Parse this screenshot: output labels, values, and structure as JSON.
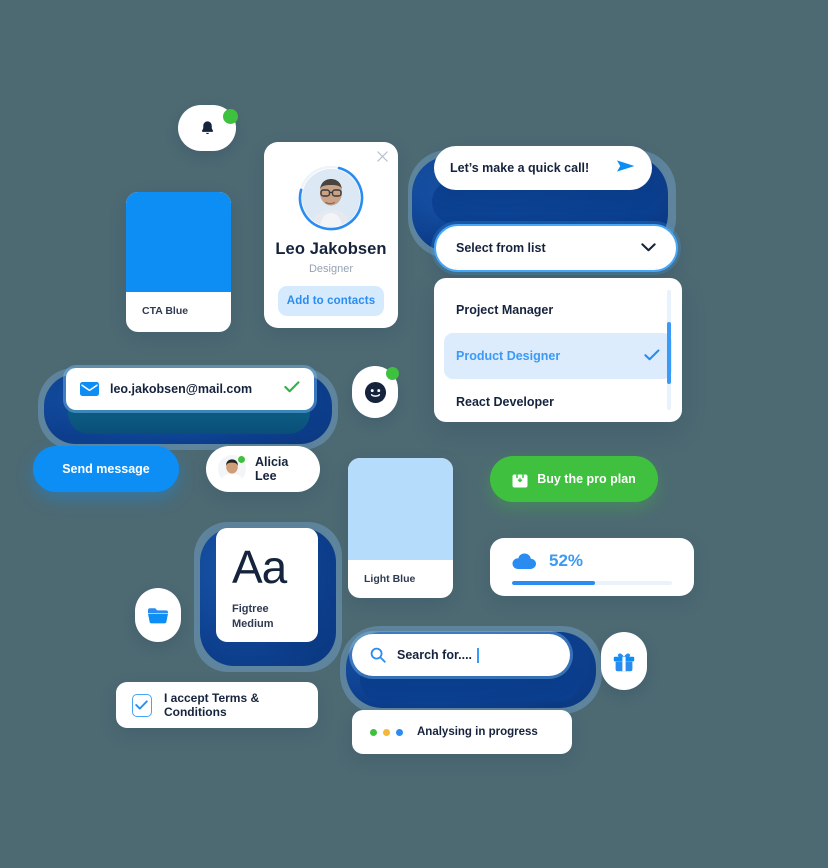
{
  "theme": {
    "background": "#4d6a73",
    "cta_blue": "#0d8ef5",
    "light_blue": "#b5dcfa",
    "navy": "#16233d",
    "green": "#3fc13f",
    "deep_navy_blob": "#0d3f8e"
  },
  "notification": {
    "icon": "bell-icon",
    "badge_color": "#3ec13e"
  },
  "profile_card": {
    "close_label": "×",
    "avatar_alt": "Leo Jakobsen avatar",
    "ring_progress": 75,
    "name": "Leo Jakobsen",
    "role": "Designer",
    "button_label": "Add to contacts"
  },
  "chat_bubble": {
    "message": "Let’s make a quick call!",
    "send_icon": "send-icon"
  },
  "select": {
    "value": "Select from list",
    "chevron_icon": "chevron-down-icon",
    "options": [
      {
        "label": "Project Manager",
        "selected": false
      },
      {
        "label": "Product Designer",
        "selected": true
      },
      {
        "label": "React Developer",
        "selected": false
      }
    ],
    "scrollbar_thumb_percent": 55
  },
  "swatches": [
    {
      "name": "CTA Blue",
      "color": "#0d8ef5"
    },
    {
      "name": "Light Blue",
      "color": "#b5dcfa"
    }
  ],
  "email_field": {
    "icon": "envelope-icon",
    "value": "leo.jakobsen@mail.com",
    "valid_icon": "check-icon",
    "valid_color": "#2fb344"
  },
  "send_button": {
    "label": "Send message"
  },
  "contact_chip": {
    "name": "Alicia Lee",
    "status": "online",
    "status_color": "#3ec13e"
  },
  "smiley_badge": {
    "icon": "smiley-icon",
    "badge_color": "#3ec13e"
  },
  "folder_badge": {
    "icon": "folder-icon"
  },
  "gift_badge": {
    "icon": "gift-icon"
  },
  "typography_card": {
    "sample": "Aa",
    "family": "Figtree",
    "weight": "Medium"
  },
  "pro_button": {
    "icon": "shopping-bag-icon",
    "label": "Buy the pro plan"
  },
  "progress_card": {
    "icon": "cloud-icon",
    "percent_label": "52%",
    "percent_value": 52
  },
  "search": {
    "icon": "search-icon",
    "placeholder": "Search for....",
    "value": "Search for...."
  },
  "terms": {
    "checked": true,
    "label": "I accept Terms & Conditions"
  },
  "analysing": {
    "label": "Analysing in progress",
    "dots": [
      "#3fc13f",
      "#f5b63c",
      "#2a8cf0"
    ]
  }
}
